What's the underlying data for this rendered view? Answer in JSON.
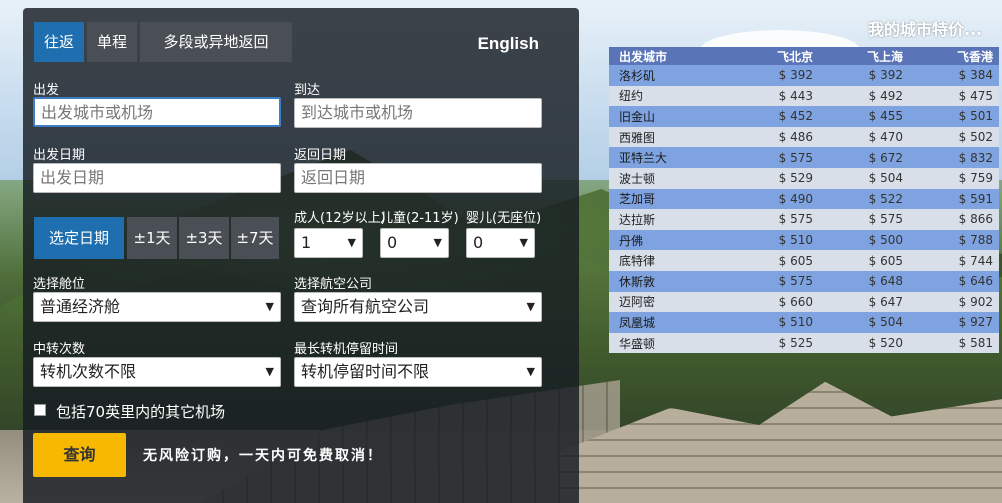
{
  "tabs": [
    {
      "label": "往返",
      "active": true
    },
    {
      "label": "单程",
      "active": false
    },
    {
      "label": "多段或异地返回",
      "active": false
    }
  ],
  "language_link": "English",
  "depart": {
    "label": "出发",
    "placeholder": "出发城市或机场"
  },
  "arrive": {
    "label": "到达",
    "placeholder": "到达城市或机场"
  },
  "depart_date": {
    "label": "出发日期",
    "placeholder": "出发日期"
  },
  "return_date": {
    "label": "返回日期",
    "placeholder": "返回日期"
  },
  "date_options": [
    {
      "label": "选定日期",
      "active": true
    },
    {
      "label": "±1天",
      "active": false
    },
    {
      "label": "±3天",
      "active": false
    },
    {
      "label": "±7天",
      "active": false
    }
  ],
  "passengers": {
    "adults": {
      "label": "成人(12岁以上)",
      "value": "1"
    },
    "children": {
      "label": "儿童(2-11岁)",
      "value": "0"
    },
    "infants": {
      "label": "婴儿(无座位)",
      "value": "0"
    }
  },
  "cabin": {
    "label": "选择舱位",
    "value": "普通经济舱"
  },
  "airline": {
    "label": "选择航空公司",
    "value": "查询所有航空公司"
  },
  "stops": {
    "label": "中转次数",
    "value": "转机次数不限"
  },
  "layover": {
    "label": "最长转机停留时间",
    "value": "转机停留时间不限"
  },
  "nearby_airports": {
    "label": "包括70英里内的其它机场",
    "checked": false
  },
  "search_button": "查询",
  "promo_text": "无风险订购，一天内可免费取消！",
  "deals": {
    "title": "我的城市特价...",
    "headers": [
      "出发城市",
      "飞北京",
      "飞上海",
      "飞香港"
    ],
    "rows": [
      [
        "洛杉矶",
        "$ 392",
        "$ 392",
        "$ 384"
      ],
      [
        "纽约",
        "$ 443",
        "$ 492",
        "$ 475"
      ],
      [
        "旧金山",
        "$ 452",
        "$ 455",
        "$ 501"
      ],
      [
        "西雅图",
        "$ 486",
        "$ 470",
        "$ 502"
      ],
      [
        "亚特兰大",
        "$ 575",
        "$ 672",
        "$ 832"
      ],
      [
        "波士顿",
        "$ 529",
        "$ 504",
        "$ 759"
      ],
      [
        "芝加哥",
        "$ 490",
        "$ 522",
        "$ 591"
      ],
      [
        "达拉斯",
        "$ 575",
        "$ 575",
        "$ 866"
      ],
      [
        "丹佛",
        "$ 510",
        "$ 500",
        "$ 788"
      ],
      [
        "底特律",
        "$ 605",
        "$ 605",
        "$ 744"
      ],
      [
        "休斯敦",
        "$ 575",
        "$ 648",
        "$ 646"
      ],
      [
        "迈阿密",
        "$ 660",
        "$ 647",
        "$ 902"
      ],
      [
        "凤凰城",
        "$ 510",
        "$ 504",
        "$ 927"
      ],
      [
        "华盛顿",
        "$ 525",
        "$ 520",
        "$ 581"
      ]
    ]
  },
  "colors": {
    "tab_active": "#1f6fb0",
    "search_button": "#f6b800",
    "table_header": "#5a74b8",
    "row_blue": "#7ea3e0",
    "row_gray": "#d8dfe8"
  }
}
